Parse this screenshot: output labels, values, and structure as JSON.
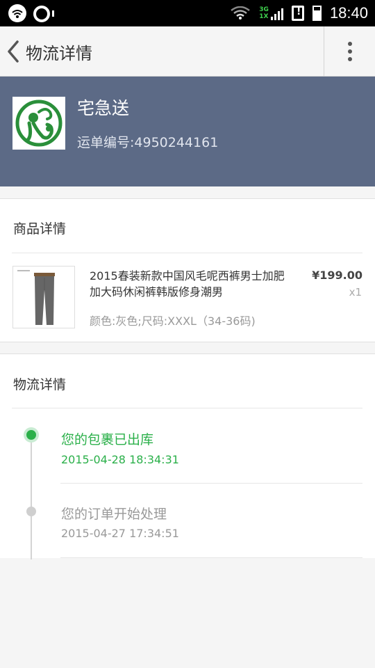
{
  "status_bar": {
    "network_label": "3G\n1X",
    "time": "18:40"
  },
  "action_bar": {
    "title": "物流详情"
  },
  "carrier": {
    "name": "宅急送",
    "tracking_number": "运单编号:4950244161"
  },
  "product_section": {
    "title": "商品详情",
    "item": {
      "name": "2015春装新款中国风毛呢西裤男士加肥加大码休闲裤韩版修身潮男",
      "spec": "颜色:灰色;尺码:XXXL（34-36码)",
      "price": "¥199.00",
      "quantity": "x1"
    }
  },
  "logistics_section": {
    "title": "物流详情",
    "events": [
      {
        "status": "您的包裹已出库",
        "time": "2015-04-28 18:34:31"
      },
      {
        "status": "您的订单开始处理",
        "time": "2015-04-27 17:34:51"
      }
    ]
  },
  "colors": {
    "carrier_header_bg": "#5c6a86",
    "accent_green": "#2bb04a",
    "inactive_gray": "#999999"
  },
  "icons": {
    "back": "chevron-left-icon",
    "overflow": "more-vertical-icon",
    "carrier_logo": "zjs-monkey-logo"
  }
}
